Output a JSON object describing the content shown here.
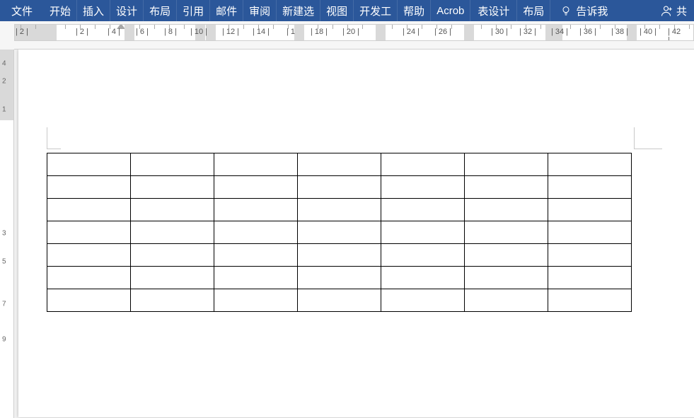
{
  "ribbon": {
    "tabs": [
      "文件",
      "开始",
      "插入",
      "设计",
      "布局",
      "引用",
      "邮件",
      "审阅",
      "新建选",
      "视图",
      "开发工",
      "帮助",
      "Acrob",
      "表设计",
      "布局"
    ],
    "tell_me": "告诉我",
    "share": "共"
  },
  "ruler": {
    "numbers": [
      "2",
      "2",
      "4",
      "6",
      "8",
      "10",
      "12",
      "14",
      "1",
      "18",
      "20",
      "24",
      "26",
      "30",
      "32",
      "34",
      "36",
      "38",
      "40",
      "42"
    ],
    "positions": [
      10,
      95,
      140,
      180,
      220,
      260,
      305,
      348,
      390,
      430,
      475,
      560,
      605,
      685,
      725,
      770,
      810,
      855,
      895,
      935
    ]
  },
  "v_ruler": {
    "numbers": [
      "4",
      "2",
      "1",
      "3",
      "5",
      "7",
      "9"
    ],
    "positions": [
      20,
      45,
      85,
      260,
      300,
      360,
      410
    ]
  },
  "table": {
    "rows": 7,
    "cols": 7
  }
}
